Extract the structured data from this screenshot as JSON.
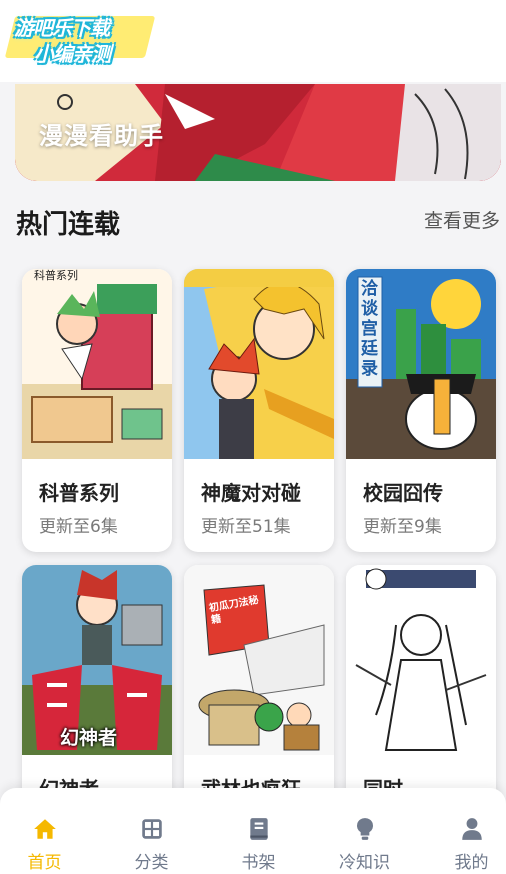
{
  "watermark": {
    "line1": "游吧乐下载",
    "line2": "小编亲测"
  },
  "banner": {
    "title": "漫漫看助手"
  },
  "section": {
    "title": "热门连载",
    "more": "查看更多"
  },
  "comics": [
    {
      "name": "科普系列",
      "update": "更新至6集",
      "cover_text": "科普系列"
    },
    {
      "name": "神魔对对碰",
      "update": "更新至51集"
    },
    {
      "name": "校园囧传",
      "update": "更新至9集",
      "cover_text": "洽谈宫廷录"
    },
    {
      "name": "幻神者",
      "update": "",
      "cover_text": "幻神者"
    },
    {
      "name": "武林也疯狂",
      "update": "",
      "cover_text": "初瓜刀法秘籍"
    },
    {
      "name": "同时",
      "update": ""
    }
  ],
  "tabs": [
    {
      "label": "首页",
      "icon": "home-icon",
      "active": true
    },
    {
      "label": "分类",
      "icon": "grid-icon",
      "active": false
    },
    {
      "label": "书架",
      "icon": "book-icon",
      "active": false
    },
    {
      "label": "冷知识",
      "icon": "lightbulb-icon",
      "active": false
    },
    {
      "label": "我的",
      "icon": "user-icon",
      "active": false
    }
  ],
  "colors": {
    "accent": "#f5b800",
    "tab_inactive": "#707a8c"
  }
}
